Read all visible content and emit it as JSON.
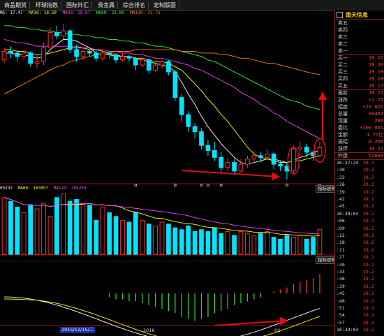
{
  "menu": [
    "商品期货",
    "环球指数",
    "国际外汇",
    "贵金属",
    "综合排名",
    "定制版面"
  ],
  "ma_legend": [
    {
      "text": "M5: 17.47",
      "color": "#ffffff"
    },
    {
      "text": "MA10: 18.50",
      "color": "#ffff00"
    },
    {
      "text": "MA30: 20.87",
      "color": "#ff40ff"
    },
    {
      "text": "MA60: 23.00",
      "color": "#30ff30"
    },
    {
      "text": "MA120: 21.75",
      "color": "#ff8000"
    }
  ],
  "volume_legend": [
    {
      "text": "05232",
      "color": "#ffffff"
    },
    {
      "text": "MA60: 183057",
      "color": "#ffff00"
    },
    {
      "text": "MA120: 198233",
      "color": "#ff40ff"
    }
  ],
  "panel_buttons": {
    "volume": "指标说明",
    "macd": "指标说明"
  },
  "x_labels": {
    "selected_date": "2015/12/15/二",
    "year": "2016",
    "month": "02"
  },
  "stock": {
    "name": "南天信息",
    "asks": [
      {
        "label": "卖五",
        "value": ""
      },
      {
        "label": "卖四",
        "value": ""
      },
      {
        "label": "卖三",
        "value": ""
      },
      {
        "label": "卖二",
        "value": ""
      },
      {
        "label": "卖一",
        "value": ""
      }
    ],
    "bids": [
      {
        "label": "买一",
        "value": "19.21"
      },
      {
        "label": "买二",
        "value": "19.20"
      },
      {
        "label": "买三",
        "value": "19.19"
      },
      {
        "label": "买四",
        "value": "19.18"
      },
      {
        "label": "买五",
        "value": "19.17"
      }
    ],
    "stats": [
      {
        "label": "最新",
        "value": "19.21"
      },
      {
        "label": "涨跌",
        "value": "+1.75"
      },
      {
        "label": "幅度",
        "value": "+10.02%"
      },
      {
        "label": "总量",
        "value": "94492"
      },
      {
        "label": "现量",
        "value": "200"
      },
      {
        "label": "委比",
        "value": "+100.00%"
      },
      {
        "label": "金额",
        "value": "1.77亿"
      },
      {
        "label": "振幅",
        "value": "0.250"
      },
      {
        "label": "涨停",
        "value": "19.21"
      }
    ],
    "outer": {
      "label": "外盘",
      "value": "52600"
    },
    "ticks": [
      {
        "time": "10:37:24",
        "price": "19.2"
      },
      {
        "time": ":30",
        "price": "19.2"
      },
      {
        "time": ":33",
        "price": "19.2"
      },
      {
        "time": ":36",
        "price": "19.2"
      },
      {
        "time": ":39",
        "price": "19.2"
      },
      {
        "time": ":42",
        "price": "19.2"
      },
      {
        "time": ":45",
        "price": "19.2"
      },
      {
        "time": "10:38:03",
        "price": "19.2"
      },
      {
        "time": ":06",
        "price": "19.2"
      },
      {
        "time": ":09",
        "price": "19.2"
      },
      {
        "time": ":12",
        "price": "19.2"
      },
      {
        "time": ":18",
        "price": "19.2"
      },
      {
        "time": ":21",
        "price": "19.2"
      },
      {
        "time": ":27",
        "price": "19.2"
      },
      {
        "time": ":30",
        "price": "19.2"
      },
      {
        "time": ":33",
        "price": "19.2"
      },
      {
        "time": ":36",
        "price": "19.2"
      },
      {
        "time": ":39",
        "price": "19.2"
      },
      {
        "time": ":45",
        "price": "19.2"
      },
      {
        "time": ":48",
        "price": "19.2"
      },
      {
        "time": ":51",
        "price": "19.2"
      },
      {
        "time": ":54",
        "price": "19.2"
      },
      {
        "time": ":57",
        "price": "19.2"
      },
      {
        "time": "10:39:03",
        "price": "19.2"
      },
      {
        "time": ":06",
        "price": "19.2"
      },
      {
        "time": ":12",
        "price": "19.2"
      },
      {
        "time": ":18",
        "price": "19.2"
      },
      {
        "time": ":21",
        "price": "19.2"
      },
      {
        "time": ":33",
        "price": "19.2"
      },
      {
        "time": ":42",
        "price": "19.2"
      },
      {
        "time": ":45",
        "price": "19.2"
      },
      {
        "time": ":48",
        "price": "19.2"
      },
      {
        "time": ":51",
        "price": "19.2"
      },
      {
        "time": ":54",
        "price": "19.2"
      },
      {
        "time": ":57",
        "price": "19.2"
      },
      {
        "time": "10:40:03",
        "price": "19.2"
      }
    ]
  },
  "colors": {
    "up": "#ff3030",
    "down": "#00e5ff",
    "annotation": "#e01010",
    "panel_border": "#8a1a1a"
  },
  "chart_data": {
    "type": "candlestick",
    "candles": [
      {
        "o": 22.6,
        "c": 23.1,
        "h": 23.3,
        "l": 22.4
      },
      {
        "o": 23.1,
        "c": 23.0,
        "h": 23.4,
        "l": 22.7
      },
      {
        "o": 23.0,
        "c": 22.8,
        "h": 23.2,
        "l": 22.5
      },
      {
        "o": 22.8,
        "c": 23.0,
        "h": 23.2,
        "l": 22.6
      },
      {
        "o": 23.0,
        "c": 22.4,
        "h": 23.1,
        "l": 22.2
      },
      {
        "o": 22.4,
        "c": 22.5,
        "h": 22.9,
        "l": 22.1
      },
      {
        "o": 22.5,
        "c": 23.3,
        "h": 23.6,
        "l": 22.3
      },
      {
        "o": 23.3,
        "c": 24.2,
        "h": 24.5,
        "l": 23.2
      },
      {
        "o": 24.2,
        "c": 24.0,
        "h": 24.6,
        "l": 23.8
      },
      {
        "o": 24.0,
        "c": 24.3,
        "h": 24.7,
        "l": 23.8
      },
      {
        "o": 24.3,
        "c": 23.2,
        "h": 24.4,
        "l": 23.0
      },
      {
        "o": 23.2,
        "c": 22.8,
        "h": 23.5,
        "l": 22.5
      },
      {
        "o": 22.8,
        "c": 23.1,
        "h": 23.3,
        "l": 22.6
      },
      {
        "o": 23.1,
        "c": 23.0,
        "h": 23.2,
        "l": 22.8
      },
      {
        "o": 23.0,
        "c": 22.7,
        "h": 23.2,
        "l": 22.5
      },
      {
        "o": 22.7,
        "c": 23.0,
        "h": 23.2,
        "l": 22.5
      },
      {
        "o": 23.0,
        "c": 22.9,
        "h": 23.1,
        "l": 22.7
      },
      {
        "o": 22.9,
        "c": 22.6,
        "h": 23.0,
        "l": 22.4
      },
      {
        "o": 22.6,
        "c": 22.8,
        "h": 23.0,
        "l": 22.5
      },
      {
        "o": 22.8,
        "c": 22.7,
        "h": 22.9,
        "l": 22.5
      },
      {
        "o": 22.7,
        "c": 22.3,
        "h": 22.8,
        "l": 22.0
      },
      {
        "o": 22.3,
        "c": 22.6,
        "h": 22.8,
        "l": 22.2
      },
      {
        "o": 22.6,
        "c": 22.0,
        "h": 22.7,
        "l": 21.8
      },
      {
        "o": 22.0,
        "c": 22.3,
        "h": 22.5,
        "l": 21.9
      },
      {
        "o": 22.3,
        "c": 22.5,
        "h": 22.6,
        "l": 22.1
      },
      {
        "o": 22.5,
        "c": 21.9,
        "h": 22.6,
        "l": 21.7
      },
      {
        "o": 21.9,
        "c": 20.4,
        "h": 22.0,
        "l": 20.2
      },
      {
        "o": 20.4,
        "c": 19.4,
        "h": 20.6,
        "l": 19.0
      },
      {
        "o": 19.4,
        "c": 18.7,
        "h": 19.6,
        "l": 18.4
      },
      {
        "o": 18.7,
        "c": 18.4,
        "h": 18.9,
        "l": 18.0
      },
      {
        "o": 18.4,
        "c": 17.6,
        "h": 18.6,
        "l": 17.4
      },
      {
        "o": 17.6,
        "c": 17.3,
        "h": 17.9,
        "l": 17.0
      },
      {
        "o": 17.3,
        "c": 16.9,
        "h": 17.8,
        "l": 16.7
      },
      {
        "o": 16.9,
        "c": 16.3,
        "h": 17.2,
        "l": 16.0
      },
      {
        "o": 16.3,
        "c": 16.6,
        "h": 16.9,
        "l": 16.1
      },
      {
        "o": 16.6,
        "c": 16.1,
        "h": 16.8,
        "l": 15.9
      },
      {
        "o": 16.1,
        "c": 16.5,
        "h": 16.8,
        "l": 16.0
      },
      {
        "o": 16.5,
        "c": 16.8,
        "h": 17.0,
        "l": 16.3
      },
      {
        "o": 16.8,
        "c": 17.0,
        "h": 17.3,
        "l": 16.6
      },
      {
        "o": 17.0,
        "c": 16.9,
        "h": 17.2,
        "l": 16.6
      },
      {
        "o": 16.9,
        "c": 17.1,
        "h": 17.4,
        "l": 16.8
      },
      {
        "o": 17.1,
        "c": 16.5,
        "h": 17.2,
        "l": 16.2
      },
      {
        "o": 16.5,
        "c": 16.4,
        "h": 16.7,
        "l": 16.1
      },
      {
        "o": 16.4,
        "c": 16.1,
        "h": 16.6,
        "l": 15.6
      },
      {
        "o": 16.1,
        "c": 17.4,
        "h": 17.6,
        "l": 15.9
      },
      {
        "o": 17.4,
        "c": 17.5,
        "h": 17.8,
        "l": 17.0
      },
      {
        "o": 17.5,
        "c": 17.2,
        "h": 17.7,
        "l": 16.9
      },
      {
        "o": 17.2,
        "c": 17.0,
        "h": 17.3,
        "l": 16.7
      },
      {
        "o": 17.0,
        "c": 17.47,
        "h": 17.8,
        "l": 16.9
      }
    ],
    "ma": [
      {
        "name": "M5",
        "color": "#ffffff",
        "values": [
          23.0,
          23.0,
          22.9,
          22.9,
          22.8,
          22.7,
          22.8,
          23.2,
          23.5,
          23.8,
          23.8,
          23.7,
          23.5,
          23.3,
          23.0,
          22.9,
          22.9,
          22.8,
          22.8,
          22.8,
          22.7,
          22.6,
          22.5,
          22.4,
          22.3,
          22.2,
          21.9,
          21.3,
          20.6,
          20.0,
          19.3,
          18.7,
          18.2,
          17.7,
          17.3,
          16.9,
          16.6,
          16.5,
          16.6,
          16.7,
          16.8,
          16.8,
          16.7,
          16.6,
          16.7,
          16.9,
          17.0,
          17.2,
          17.3
        ]
      },
      {
        "name": "MA10",
        "color": "#ffff00",
        "values": [
          23.2,
          23.2,
          23.1,
          23.1,
          23.0,
          22.9,
          22.9,
          23.0,
          23.1,
          23.2,
          23.3,
          23.3,
          23.3,
          23.2,
          23.2,
          23.1,
          23.0,
          22.9,
          22.8,
          22.8,
          22.7,
          22.7,
          22.6,
          22.5,
          22.5,
          22.4,
          22.2,
          22.0,
          21.6,
          21.2,
          20.8,
          20.3,
          19.9,
          19.4,
          19.0,
          18.5,
          18.0,
          17.5,
          17.1,
          16.9,
          16.8,
          16.7,
          16.6,
          16.6,
          16.7,
          16.7,
          16.8,
          16.9,
          17.0
        ]
      },
      {
        "name": "MA30",
        "color": "#ff40ff",
        "values": [
          23.8,
          23.7,
          23.6,
          23.6,
          23.5,
          23.4,
          23.4,
          23.4,
          23.4,
          23.4,
          23.4,
          23.4,
          23.3,
          23.3,
          23.2,
          23.2,
          23.1,
          23.1,
          23.0,
          23.0,
          22.9,
          22.9,
          22.8,
          22.7,
          22.7,
          22.6,
          22.5,
          22.4,
          22.3,
          22.1,
          22.0,
          21.8,
          21.6,
          21.4,
          21.2,
          21.0,
          20.7,
          20.5,
          20.3,
          20.0,
          19.8,
          19.5,
          19.3,
          19.0,
          18.8,
          18.6,
          18.4,
          18.2,
          18.0
        ]
      },
      {
        "name": "MA60",
        "color": "#30ff30",
        "values": [
          24.6,
          24.6,
          24.5,
          24.5,
          24.4,
          24.4,
          24.3,
          24.3,
          24.2,
          24.2,
          24.1,
          24.1,
          24.0,
          24.0,
          23.9,
          23.9,
          23.8,
          23.8,
          23.7,
          23.7,
          23.6,
          23.6,
          23.5,
          23.4,
          23.4,
          23.3,
          23.2,
          23.1,
          23.0,
          22.9,
          22.8,
          22.6,
          22.5,
          22.3,
          22.1,
          21.9,
          21.7,
          21.5,
          21.3,
          21.1,
          20.9,
          20.7,
          20.5,
          20.3,
          20.2,
          20.1,
          19.9,
          19.8,
          19.7
        ]
      },
      {
        "name": "MA120",
        "color": "#ff8000",
        "values": [
          20.6,
          20.8,
          21.0,
          21.2,
          21.4,
          21.6,
          21.8,
          22.0,
          22.2,
          22.3,
          22.5,
          22.6,
          22.7,
          22.8,
          22.9,
          23.0,
          23.0,
          23.1,
          23.1,
          23.1,
          23.2,
          23.2,
          23.2,
          23.2,
          23.2,
          23.2,
          23.2,
          23.1,
          23.1,
          23.1,
          23.0,
          23.0,
          23.0,
          22.9,
          22.9,
          22.8,
          22.7,
          22.7,
          22.6,
          22.5,
          22.4,
          22.4,
          22.3,
          22.2,
          22.1,
          22.0,
          21.9,
          21.8,
          21.75
        ]
      }
    ],
    "volume": [
      30,
      28,
      25,
      22,
      26,
      24,
      27,
      20,
      30,
      32,
      28,
      29,
      27,
      26,
      18,
      25,
      22,
      20,
      18,
      17,
      22,
      18,
      16,
      15,
      17,
      16,
      14,
      13,
      15,
      12,
      13,
      12,
      14,
      11,
      12,
      10,
      12,
      11,
      10,
      11,
      12,
      9,
      8,
      10,
      9,
      10,
      8,
      9,
      13
    ],
    "macd_bars": [
      0,
      0,
      0,
      0,
      0,
      0,
      0,
      0,
      0,
      0,
      0,
      0,
      0,
      0,
      0,
      0,
      -0.2,
      -0.3,
      -0.3,
      -0.4,
      -0.4,
      -0.5,
      -0.6,
      -0.7,
      -0.8,
      -0.9,
      -1.0,
      -1.2,
      -1.3,
      -1.4,
      -1.3,
      -1.2,
      -1.0,
      -0.9,
      -0.8,
      -0.6,
      -0.5,
      -0.4,
      -0.3,
      -0.2,
      0.0,
      0.1,
      0.2,
      0.3,
      0.5,
      0.6,
      0.7,
      0.8,
      1.0
    ]
  }
}
